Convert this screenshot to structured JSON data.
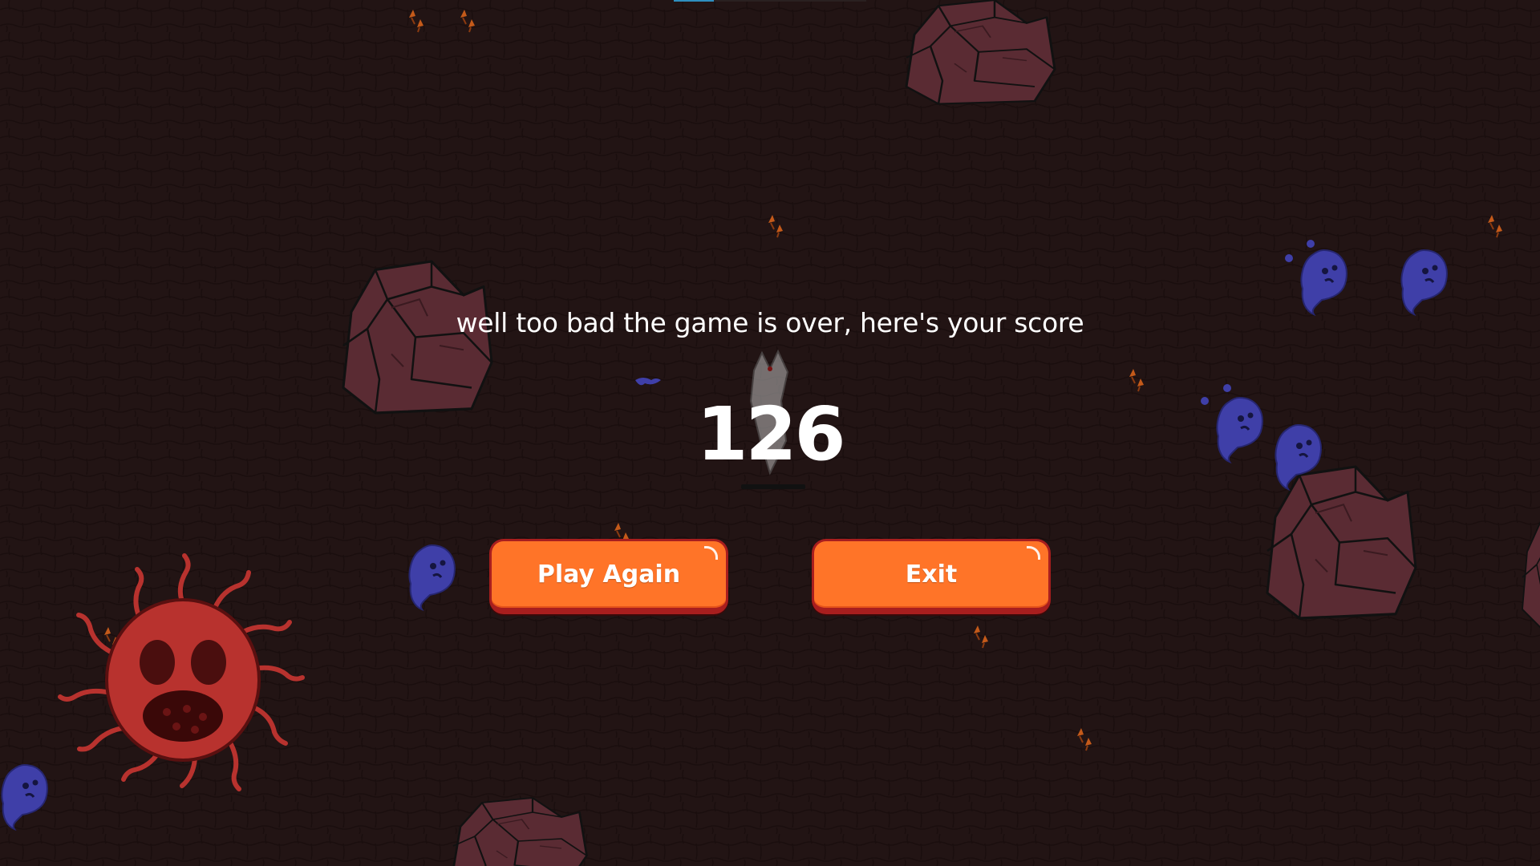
{
  "game_over": {
    "message": "well too bad the game is over, here's your score",
    "score": "126"
  },
  "buttons": {
    "play_again_label": "Play Again",
    "exit_label": "Exit"
  },
  "colors": {
    "background": "#221414",
    "button_fill": "#ff7428",
    "button_border": "#a81e1e",
    "rock": "#5a2b33",
    "ghost": "#3f3fa8",
    "boss": "#b8322e",
    "ember": "#c45a1a"
  },
  "icons": {
    "rock": "rock-obstacle",
    "ghost": "ghost-enemy",
    "boss": "tentacle-skull-boss",
    "ember": "ember-particles",
    "player": "player-character"
  }
}
